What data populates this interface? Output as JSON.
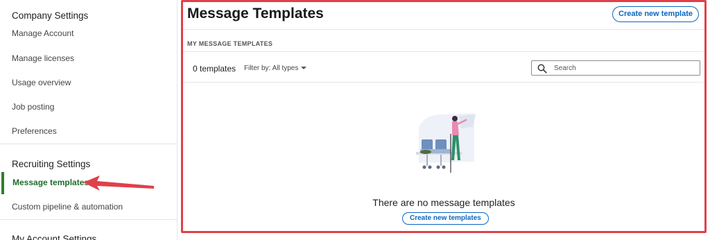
{
  "sidebar": {
    "company_heading": "Company Settings",
    "company_items": [
      "Manage Account",
      "Manage licenses",
      "Usage overview",
      "Job posting",
      "Preferences"
    ],
    "recruiting_heading": "Recruiting Settings",
    "recruiting_items": [
      "Message templates",
      "Custom pipeline & automation"
    ],
    "account_heading": "My Account Settings",
    "active_item": "Message templates"
  },
  "main": {
    "title": "Message Templates",
    "create_button": "Create new template",
    "section_label": "MY MESSAGE TEMPLATES",
    "count": "0 templates",
    "filter_label": "Filter by: All types",
    "search_placeholder": "Search",
    "empty_text": "There are no message templates",
    "empty_button": "Create new templates"
  },
  "colors": {
    "accent": "#0a66c2",
    "active_green": "#2e7d32",
    "annotation_red": "#e0404a"
  },
  "icons": {
    "search": "search-icon",
    "filter_caret": "caret-down-icon",
    "annotation_arrow": "arrow-left-icon"
  }
}
